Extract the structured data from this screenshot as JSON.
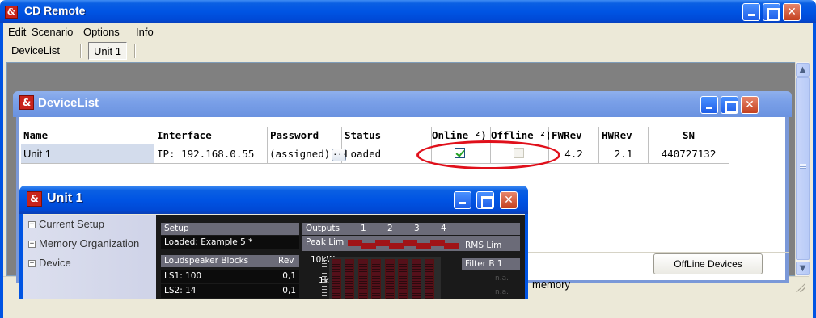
{
  "app": {
    "title": "CD Remote",
    "icon": "ampersand-app-icon"
  },
  "menu": [
    "Edit",
    "Scenario",
    "Options",
    "Info"
  ],
  "tabs": [
    "DeviceList",
    "Unit 1"
  ],
  "device_list": {
    "title": "DeviceList",
    "columns": [
      "Name",
      "Interface",
      "Password",
      "Status",
      "Online ²)",
      "Offline ²)",
      "FWRev",
      "HWRev",
      "SN"
    ],
    "rows": [
      {
        "name": "Unit 1",
        "interface": "IP: 192.168.0.55",
        "password": "(assigned)",
        "password_button": "...",
        "status": "Loaded",
        "online": true,
        "offline": false,
        "fwrev": "4.2",
        "hwrev": "2.1",
        "sn": "440727132"
      }
    ],
    "memory_text": "memory",
    "offline_button": "OffLine Devices"
  },
  "unit_window": {
    "title": "Unit 1",
    "tree": [
      "Current Setup",
      "Memory Organization",
      "Device"
    ],
    "tree_expander": "+",
    "setup_label": "Setup",
    "loaded_text": "Loaded: Example 5 *",
    "ls_blocks_label": "Loudspeaker Blocks",
    "rev_label": "Rev",
    "ls_rows": [
      {
        "label": "LS1: 100",
        "rev": "0,1"
      },
      {
        "label": "LS2: 14",
        "rev": "0,1"
      }
    ],
    "outputs_label": "Outputs",
    "output_channels": [
      "1",
      "2",
      "3",
      "4"
    ],
    "peak_lim_label": "Peak Lim",
    "rms_lim_label": "RMS Lim",
    "scale_10k": "10kW",
    "scale_1k": "1kW",
    "filter_label": "Filter B 1",
    "na_text": "n.a."
  },
  "colors": {
    "title_blue": "#0054e3",
    "check_green": "#21a121",
    "annotation_red": "#e0101b",
    "peak_red": "#a01416"
  }
}
